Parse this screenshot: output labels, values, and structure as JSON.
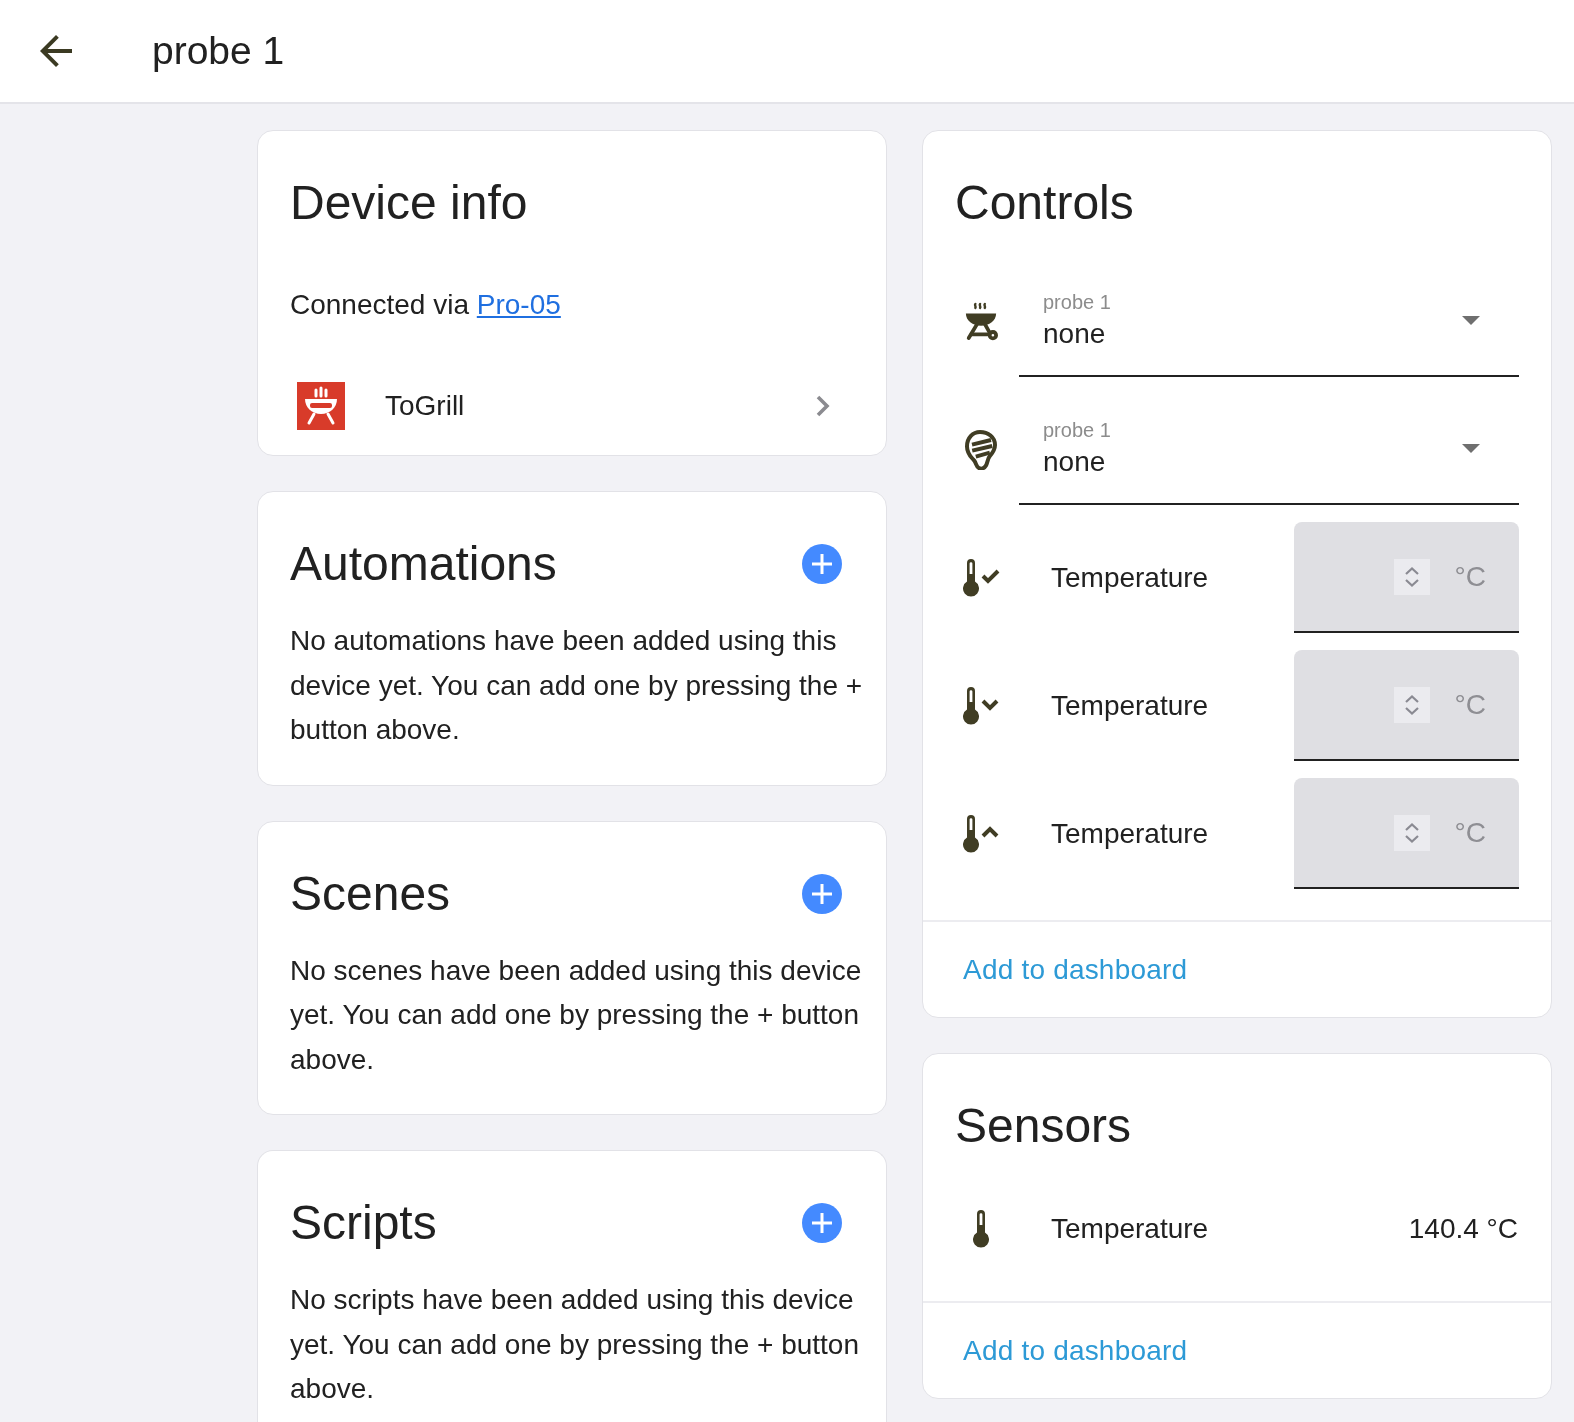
{
  "header": {
    "title": "probe 1"
  },
  "device_info": {
    "title": "Device info",
    "connection": {
      "text": "Connected via",
      "link": "Pro-05"
    },
    "integration": {
      "name": "ToGrill"
    }
  },
  "related": [
    {
      "title": "Automations",
      "message": "No automations have been added using this device yet. You can add one by pressing the + button above."
    },
    {
      "title": "Scenes",
      "message": "No scenes have been added using this device yet. You can add one by pressing the + button above."
    },
    {
      "title": "Scripts",
      "message": "No scripts have been added using this device yet. You can add one by pressing the + button above."
    }
  ],
  "controls": {
    "title": "Controls",
    "items": [
      {
        "kind": "select",
        "label": "probe 1",
        "value": "none"
      },
      {
        "kind": "select",
        "label": "probe 1",
        "value": "none"
      },
      {
        "kind": "number",
        "name": "Temperature",
        "unit": "°C"
      },
      {
        "kind": "number",
        "name": "Temperature",
        "unit": "°C"
      },
      {
        "kind": "number",
        "name": "Temperature",
        "unit": "°C"
      }
    ],
    "action": "Add to dashboard"
  },
  "sensors": {
    "title": "Sensors",
    "items": [
      {
        "name": "Temperature",
        "value": "140.4 °C"
      }
    ],
    "action": "Add to dashboard"
  }
}
